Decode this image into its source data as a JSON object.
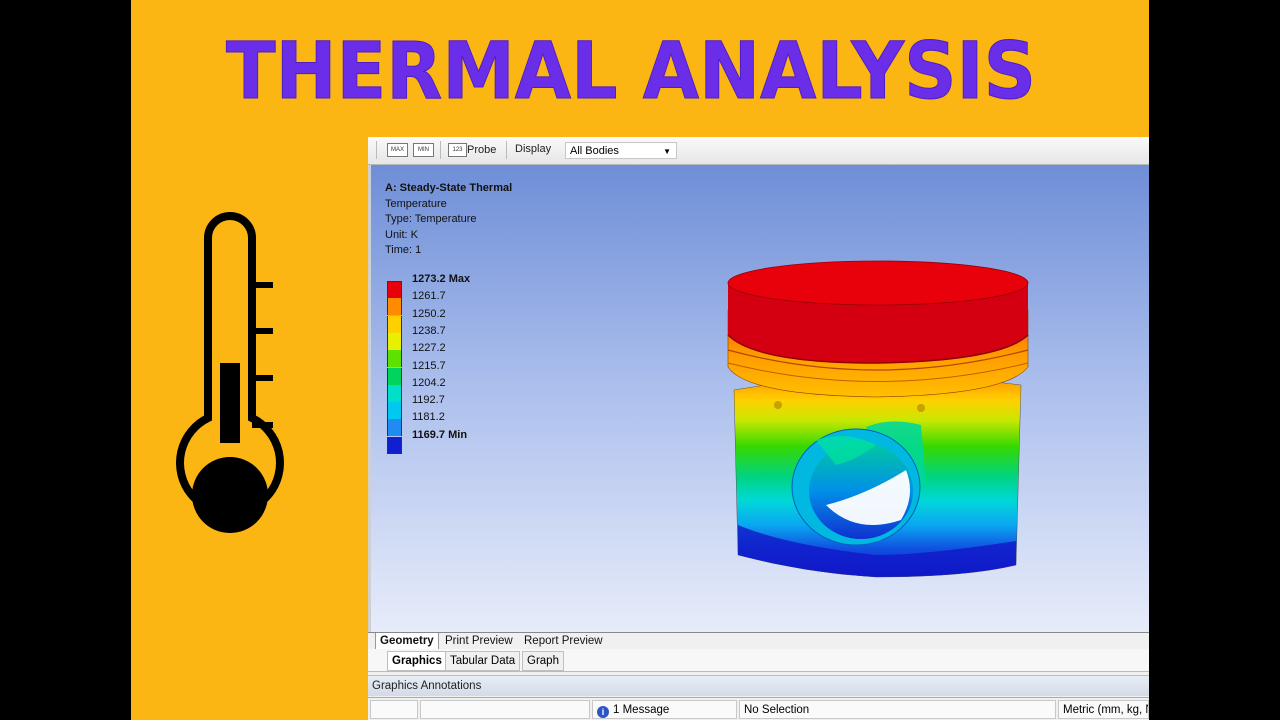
{
  "banner": {
    "title": "THERMAL ANALYSIS",
    "title_color": "#6a2ee8",
    "background": "#fbb614"
  },
  "toolbar": {
    "max_label": "MAX",
    "min_label": "MIN",
    "probe_icon": "123",
    "probe_label": "Probe",
    "display_label": "Display",
    "display_value": "All Bodies"
  },
  "result_info": {
    "analysis": "A: Steady-State Thermal",
    "result": "Temperature",
    "type": "Type: Temperature",
    "unit": "Unit: K",
    "time": "Time: 1"
  },
  "legend": {
    "entries": [
      {
        "label": "1273.2 Max",
        "color": "#e8000b",
        "bold": true
      },
      {
        "label": "1261.7",
        "color": "#ff8c00"
      },
      {
        "label": "1250.2",
        "color": "#ffd000"
      },
      {
        "label": "1238.7",
        "color": "#e6f000"
      },
      {
        "label": "1227.2",
        "color": "#5ee000"
      },
      {
        "label": "1215.7",
        "color": "#00d45c"
      },
      {
        "label": "1204.2",
        "color": "#00e0c8"
      },
      {
        "label": "1192.7",
        "color": "#00c8f0"
      },
      {
        "label": "1181.2",
        "color": "#1e8cf0"
      },
      {
        "label": "1169.7 Min",
        "color": "#1020d0",
        "bold": true
      }
    ]
  },
  "tabs_top": [
    "Geometry",
    "Print Preview",
    "Report Preview"
  ],
  "tabs_bottom": [
    "Graphics",
    "Tabular Data",
    "Graph"
  ],
  "annotations_label": "Graphics Annotations",
  "status": {
    "message_icon": "i",
    "message": "1 Message",
    "selection": "No Selection",
    "units": "Metric (mm, kg, N"
  }
}
